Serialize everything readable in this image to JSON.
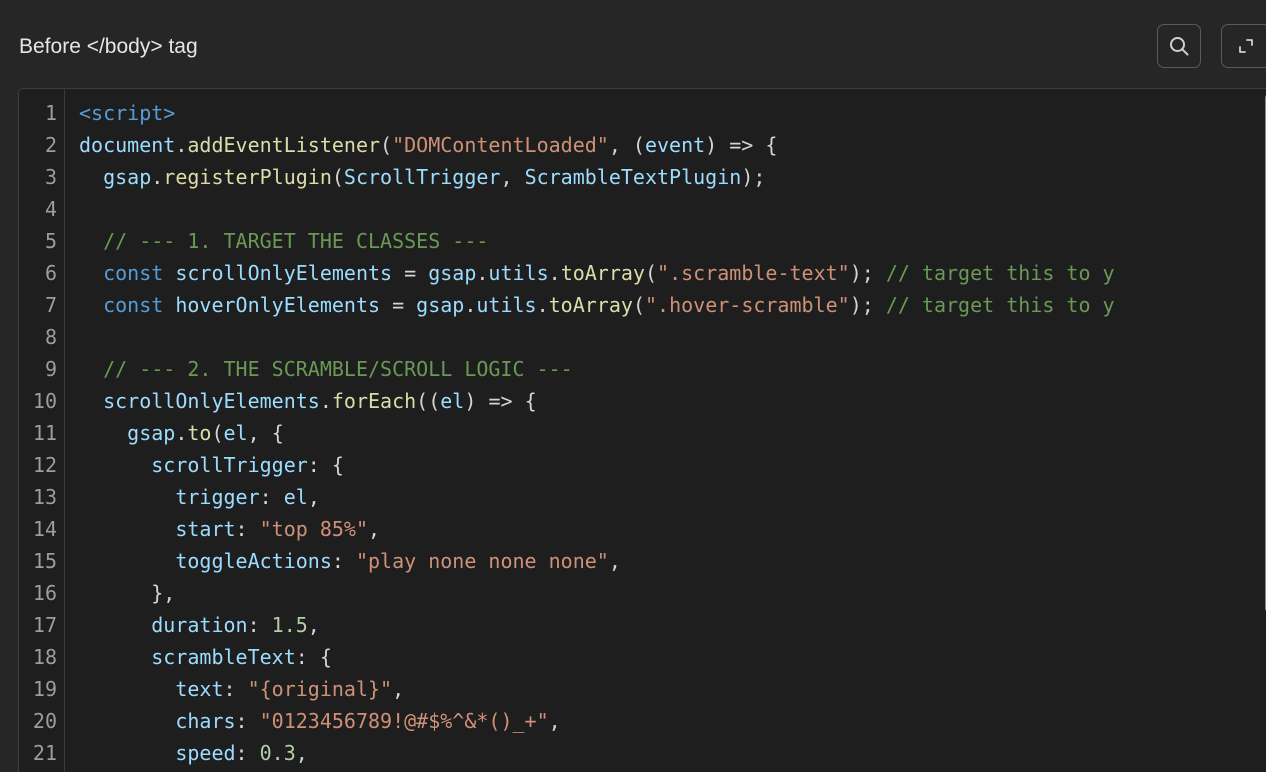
{
  "header": {
    "title": "Before </body> tag",
    "search_icon": "search-icon",
    "expand_icon": "expand-icon"
  },
  "editor": {
    "lines": [
      {
        "n": "1",
        "tokens": [
          {
            "t": "<script>",
            "c": "tag"
          }
        ]
      },
      {
        "n": "2",
        "tokens": [
          {
            "t": "document",
            "c": "var"
          },
          {
            "t": ".",
            "c": "pl"
          },
          {
            "t": "addEventListener",
            "c": "fn"
          },
          {
            "t": "(",
            "c": "pl"
          },
          {
            "t": "\"DOMContentLoaded\"",
            "c": "str"
          },
          {
            "t": ", (",
            "c": "pl"
          },
          {
            "t": "event",
            "c": "var"
          },
          {
            "t": ") => {",
            "c": "pl"
          }
        ]
      },
      {
        "n": "3",
        "tokens": [
          {
            "t": "  gsap",
            "c": "var"
          },
          {
            "t": ".",
            "c": "pl"
          },
          {
            "t": "registerPlugin",
            "c": "fn"
          },
          {
            "t": "(",
            "c": "pl"
          },
          {
            "t": "ScrollTrigger",
            "c": "var"
          },
          {
            "t": ", ",
            "c": "pl"
          },
          {
            "t": "ScrambleTextPlugin",
            "c": "var"
          },
          {
            "t": ");",
            "c": "pl"
          }
        ]
      },
      {
        "n": "4",
        "tokens": []
      },
      {
        "n": "5",
        "tokens": [
          {
            "t": "  // --- 1. TARGET THE CLASSES ---",
            "c": "com"
          }
        ]
      },
      {
        "n": "6",
        "tokens": [
          {
            "t": "  const ",
            "c": "kw"
          },
          {
            "t": "scrollOnlyElements",
            "c": "var"
          },
          {
            "t": " = ",
            "c": "pl"
          },
          {
            "t": "gsap",
            "c": "var"
          },
          {
            "t": ".",
            "c": "pl"
          },
          {
            "t": "utils",
            "c": "var"
          },
          {
            "t": ".",
            "c": "pl"
          },
          {
            "t": "toArray",
            "c": "fn"
          },
          {
            "t": "(",
            "c": "pl"
          },
          {
            "t": "\".scramble-text\"",
            "c": "str"
          },
          {
            "t": "); ",
            "c": "pl"
          },
          {
            "t": "// target this to y",
            "c": "com"
          }
        ]
      },
      {
        "n": "7",
        "tokens": [
          {
            "t": "  const ",
            "c": "kw"
          },
          {
            "t": "hoverOnlyElements",
            "c": "var"
          },
          {
            "t": " = ",
            "c": "pl"
          },
          {
            "t": "gsap",
            "c": "var"
          },
          {
            "t": ".",
            "c": "pl"
          },
          {
            "t": "utils",
            "c": "var"
          },
          {
            "t": ".",
            "c": "pl"
          },
          {
            "t": "toArray",
            "c": "fn"
          },
          {
            "t": "(",
            "c": "pl"
          },
          {
            "t": "\".hover-scramble\"",
            "c": "str"
          },
          {
            "t": "); ",
            "c": "pl"
          },
          {
            "t": "// target this to y",
            "c": "com"
          }
        ]
      },
      {
        "n": "8",
        "tokens": []
      },
      {
        "n": "9",
        "tokens": [
          {
            "t": "  // --- 2. THE SCRAMBLE/SCROLL LOGIC ---",
            "c": "com"
          }
        ]
      },
      {
        "n": "10",
        "tokens": [
          {
            "t": "  scrollOnlyElements",
            "c": "var"
          },
          {
            "t": ".",
            "c": "pl"
          },
          {
            "t": "forEach",
            "c": "fn"
          },
          {
            "t": "((",
            "c": "pl"
          },
          {
            "t": "el",
            "c": "var"
          },
          {
            "t": ") => {",
            "c": "pl"
          }
        ]
      },
      {
        "n": "11",
        "tokens": [
          {
            "t": "    gsap",
            "c": "var"
          },
          {
            "t": ".",
            "c": "pl"
          },
          {
            "t": "to",
            "c": "fn"
          },
          {
            "t": "(",
            "c": "pl"
          },
          {
            "t": "el",
            "c": "var"
          },
          {
            "t": ", {",
            "c": "pl"
          }
        ]
      },
      {
        "n": "12",
        "tokens": [
          {
            "t": "      scrollTrigger",
            "c": "var"
          },
          {
            "t": ": {",
            "c": "pl"
          }
        ]
      },
      {
        "n": "13",
        "tokens": [
          {
            "t": "        trigger",
            "c": "var"
          },
          {
            "t": ": ",
            "c": "pl"
          },
          {
            "t": "el",
            "c": "var"
          },
          {
            "t": ",",
            "c": "pl"
          }
        ]
      },
      {
        "n": "14",
        "tokens": [
          {
            "t": "        start",
            "c": "var"
          },
          {
            "t": ": ",
            "c": "pl"
          },
          {
            "t": "\"top 85%\"",
            "c": "str"
          },
          {
            "t": ",",
            "c": "pl"
          }
        ]
      },
      {
        "n": "15",
        "tokens": [
          {
            "t": "        toggleActions",
            "c": "var"
          },
          {
            "t": ": ",
            "c": "pl"
          },
          {
            "t": "\"play none none none\"",
            "c": "str"
          },
          {
            "t": ",",
            "c": "pl"
          }
        ]
      },
      {
        "n": "16",
        "tokens": [
          {
            "t": "      },",
            "c": "pl"
          }
        ]
      },
      {
        "n": "17",
        "tokens": [
          {
            "t": "      duration",
            "c": "var"
          },
          {
            "t": ": ",
            "c": "pl"
          },
          {
            "t": "1.5",
            "c": "num"
          },
          {
            "t": ",",
            "c": "pl"
          }
        ]
      },
      {
        "n": "18",
        "tokens": [
          {
            "t": "      scrambleText",
            "c": "var"
          },
          {
            "t": ": {",
            "c": "pl"
          }
        ]
      },
      {
        "n": "19",
        "tokens": [
          {
            "t": "        text",
            "c": "var"
          },
          {
            "t": ": ",
            "c": "pl"
          },
          {
            "t": "\"{original}\"",
            "c": "str"
          },
          {
            "t": ",",
            "c": "pl"
          }
        ]
      },
      {
        "n": "20",
        "tokens": [
          {
            "t": "        chars",
            "c": "var"
          },
          {
            "t": ": ",
            "c": "pl"
          },
          {
            "t": "\"0123456789!@#$%^&*()_+\"",
            "c": "str"
          },
          {
            "t": ",",
            "c": "pl"
          }
        ]
      },
      {
        "n": "21",
        "tokens": [
          {
            "t": "        speed",
            "c": "var"
          },
          {
            "t": ": ",
            "c": "pl"
          },
          {
            "t": "0.3",
            "c": "num"
          },
          {
            "t": ",",
            "c": "pl"
          }
        ]
      }
    ]
  }
}
